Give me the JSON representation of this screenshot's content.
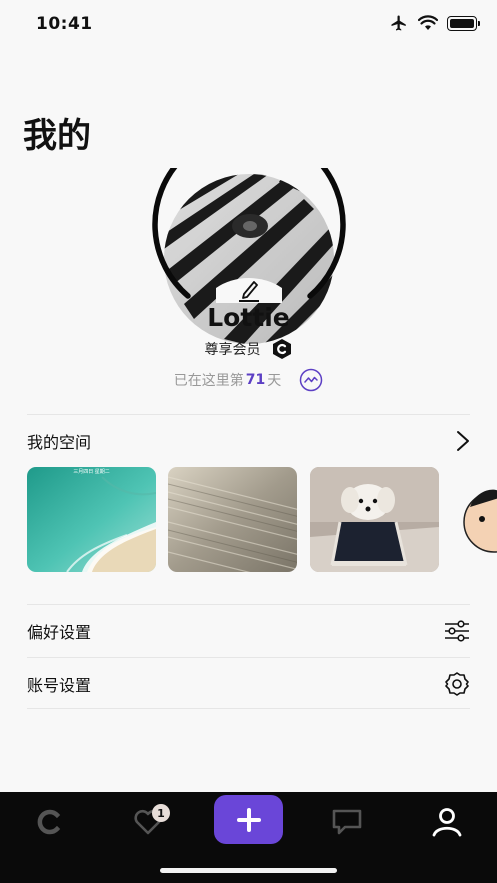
{
  "status_bar": {
    "time": "10:41"
  },
  "page": {
    "title": "我的"
  },
  "profile": {
    "username": "Lottie",
    "membership_label": "尊享会员",
    "days_prefix": "已在这里第",
    "days_count": "71",
    "days_suffix": "天"
  },
  "space": {
    "title": "我的空间",
    "thumbnail_caption": "三月四日 星期二"
  },
  "settings": {
    "items": [
      {
        "label": "偏好设置",
        "icon": "sliders-icon"
      },
      {
        "label": "账号设置",
        "icon": "gear-icon"
      }
    ]
  },
  "tab_bar": {
    "items": [
      {
        "name": "home",
        "icon": "c-logo-icon"
      },
      {
        "name": "favorites",
        "icon": "heart-icon",
        "badge": "1"
      },
      {
        "name": "create",
        "icon": "plus-icon"
      },
      {
        "name": "messages",
        "icon": "chat-icon"
      },
      {
        "name": "profile",
        "icon": "person-icon",
        "active": true
      }
    ]
  },
  "colors": {
    "accent": "#6a46d8",
    "days_count": "#5c3fc4",
    "tab_bar": "#0a0a0a"
  }
}
